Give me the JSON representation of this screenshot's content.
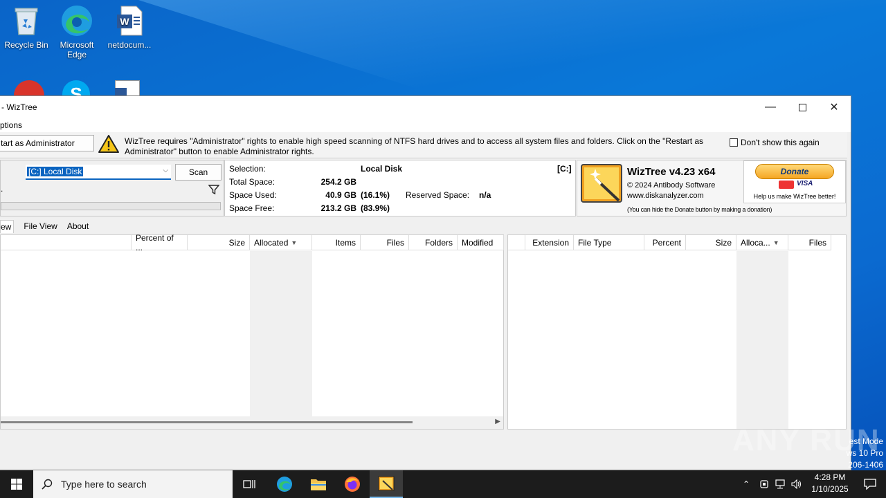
{
  "desktop": {
    "icons": [
      {
        "label": "Recycle Bin"
      },
      {
        "label": "Microsoft Edge"
      },
      {
        "label": "netdocum..."
      }
    ]
  },
  "window": {
    "title": "- WizTree",
    "menu": {
      "options": "ptions"
    },
    "admin_bar": {
      "restart_button": "tart as Administrator",
      "message": "WizTree requires \"Administrator\" rights to enable high speed scanning of NTFS hard drives and to access all system files and folders. Click on the \"Restart as Administrator\" button to enable Administrator rights.",
      "dont_show": "Don't show this again"
    },
    "drive_select": {
      "selected": "[C:] Local Disk",
      "scan_label": "Scan"
    },
    "info": {
      "selection_label": "Selection:",
      "selection_drive": "[C:]",
      "selection_value": "Local Disk",
      "total_label": "Total Space:",
      "total_value": "254.2 GB",
      "used_label": "Space Used:",
      "used_value": "40.9 GB",
      "used_pct": "(16.1%)",
      "reserved_label": "Reserved Space:",
      "reserved_value": "n/a",
      "free_label": "Space Free:",
      "free_value": "213.2 GB",
      "free_pct": "(83.9%)"
    },
    "logo": {
      "product": "WizTree v4.23 x64",
      "copyright": "© 2024 Antibody Software",
      "site": "www.diskanalyzer.com",
      "donate_label": "Donate",
      "help_text": "Help us make WizTree better!",
      "hide_note": "(You can hide the Donate button by making a donation)"
    },
    "tabs": [
      "ew",
      "File View",
      "About"
    ],
    "tree_columns": [
      "Percent of ...",
      "Size",
      "Allocated",
      "Items",
      "Files",
      "Folders",
      "Modified"
    ],
    "ext_columns": [
      "Extension",
      "File Type",
      "Percent",
      "Size",
      "Alloca...",
      "Files"
    ]
  },
  "taskbar": {
    "search_placeholder": "Type here to search",
    "time": "4:28 PM",
    "date": "1/10/2025"
  },
  "watermark": {
    "line1": "est Mode",
    "line2": "ws 10 Pro",
    "line3": "206-1406",
    "brand": "ANY RUN"
  }
}
